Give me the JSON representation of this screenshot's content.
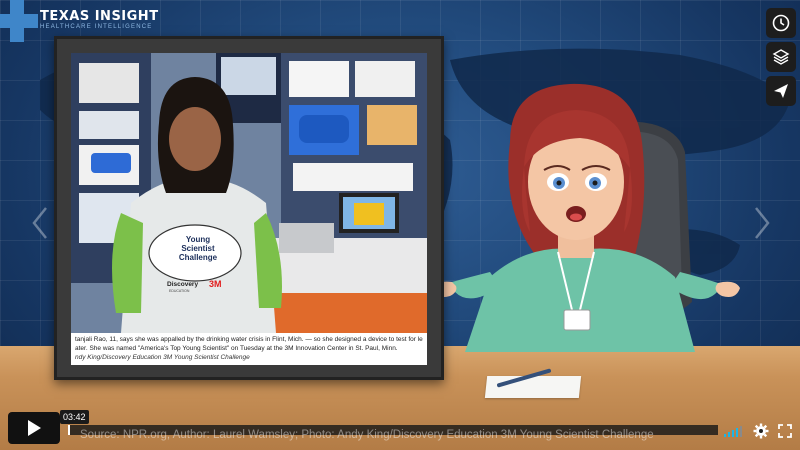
{
  "logo": {
    "title": "TEXAS INSIGHT",
    "subtitle": "HEALTHCARE INTELLIGENCE"
  },
  "news_photo": {
    "shirt_text_line1": "Young",
    "shirt_text_line2": "Scientist",
    "shirt_text_line3": "Challenge",
    "shirt_brand": "Discovery",
    "shirt_brand_sub": "EDUCATION",
    "shirt_logo_3m": "3M",
    "caption_line1": "tanjali Rao, 11, says she was appalled by the drinking water crisis in Flint, Mich. — so she designed a device to test for lead",
    "caption_line2": "ater. She was named \"America's Top Young Scientist\" on Tuesday at the 3M Innovation Center in St. Paul, Minn.",
    "caption_credit": "ndy King/Discovery Education 3M Young Scientist Challenge"
  },
  "side_controls": [
    {
      "icon": "clock-icon",
      "label": "Watch later"
    },
    {
      "icon": "layers-icon",
      "label": "Collections"
    },
    {
      "icon": "send-icon",
      "label": "Share"
    }
  ],
  "player": {
    "current_time": "03:42",
    "progress": 0.0,
    "source_caption": "Source: NPR.org, Author: Laurel Wamsley; Photo: Andy King/Discovery Education 3M Young Scientist Challenge"
  },
  "colors": {
    "accent": "#1cb5e6",
    "logo_blue": "#3f86c9",
    "background": "#214a7c",
    "desk": "#c99259"
  }
}
